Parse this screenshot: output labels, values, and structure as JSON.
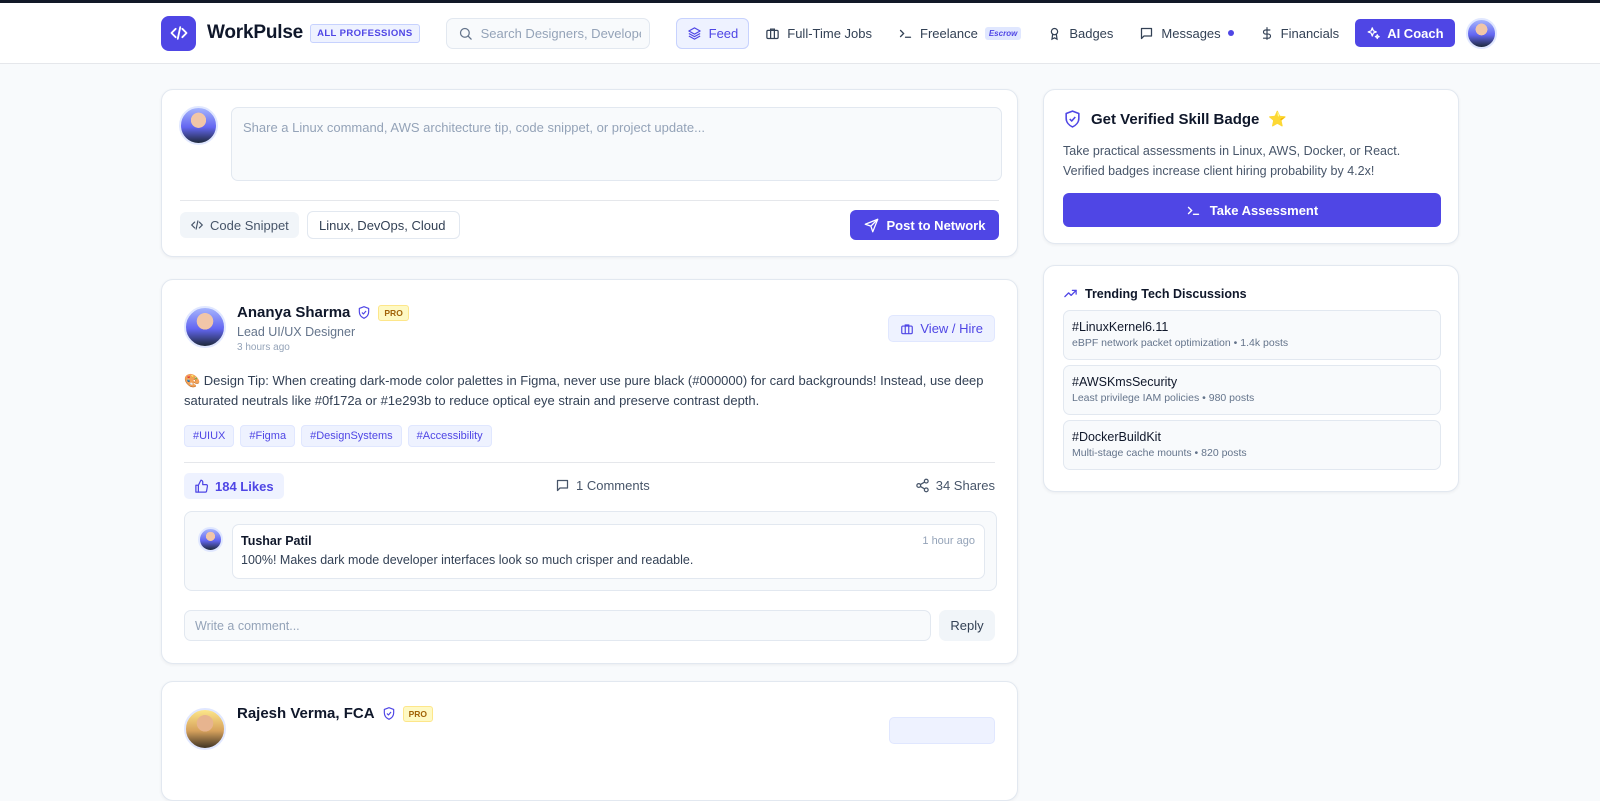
{
  "nav": {
    "brand": "WorkPulse",
    "brand_badge": "ALL PROFESSIONS",
    "search_placeholder": "Search Designers, Developers...",
    "items": [
      {
        "label": "Feed",
        "icon": "layers-icon",
        "active": true
      },
      {
        "label": "Full-Time Jobs",
        "icon": "briefcase-icon"
      },
      {
        "label": "Freelance",
        "icon": "terminal-icon",
        "badge": "Escrow"
      },
      {
        "label": "Badges",
        "icon": "award-icon"
      },
      {
        "label": "Messages",
        "icon": "message-icon",
        "dot": true
      },
      {
        "label": "Financials",
        "icon": "dollar-icon"
      }
    ],
    "ai_coach": "AI Coach"
  },
  "composer": {
    "placeholder": "Share a Linux command, AWS architecture tip, code snippet, or project update...",
    "code_snippet_label": "Code Snippet",
    "tags_value": "Linux, DevOps, Cloud",
    "post_label": "Post to Network"
  },
  "post": {
    "author": "Ananya Sharma",
    "badge": "PRO",
    "role": "Lead UI/UX Designer",
    "time": "3 hours ago",
    "hire_label": "View / Hire",
    "body": "🎨 Design Tip: When creating dark-mode color palettes in Figma, never use pure black (#000000) for card backgrounds! Instead, use deep saturated neutrals like #0f172a or #1e293b to reduce optical eye strain and preserve contrast depth.",
    "hashtags": [
      "#UIUX",
      "#Figma",
      "#DesignSystems",
      "#Accessibility"
    ],
    "likes": "184 Likes",
    "comments": "1 Comments",
    "shares": "34 Shares",
    "comment": {
      "author": "Tushar Patil",
      "time": "1 hour ago",
      "text": "100%! Makes dark mode developer interfaces look so much crisper and readable."
    },
    "reply_placeholder": "Write a comment...",
    "reply_label": "Reply"
  },
  "post2": {
    "author": "Rajesh Verma, FCA",
    "badge": "PRO"
  },
  "badge_card": {
    "title": "Get Verified Skill Badge",
    "star": "⭐",
    "description": "Take practical assessments in Linux, AWS, Docker, or React. Verified badges increase client hiring probability by 4.2x!",
    "button": "Take Assessment"
  },
  "trending": {
    "title": "Trending Tech Discussions",
    "topics": [
      {
        "tag": "#LinuxKernel6.11",
        "meta": "eBPF network packet optimization • 1.4k posts"
      },
      {
        "tag": "#AWSKmsSecurity",
        "meta": "Least privilege IAM policies • 980 posts"
      },
      {
        "tag": "#DockerBuildKit",
        "meta": "Multi-stage cache mounts • 820 posts"
      }
    ]
  },
  "colors": {
    "accent": "#4f46e5",
    "accent_soft": "#eef2ff",
    "pro_badge": "#fef9c3",
    "text": "#0f172a",
    "muted": "#64748b"
  }
}
